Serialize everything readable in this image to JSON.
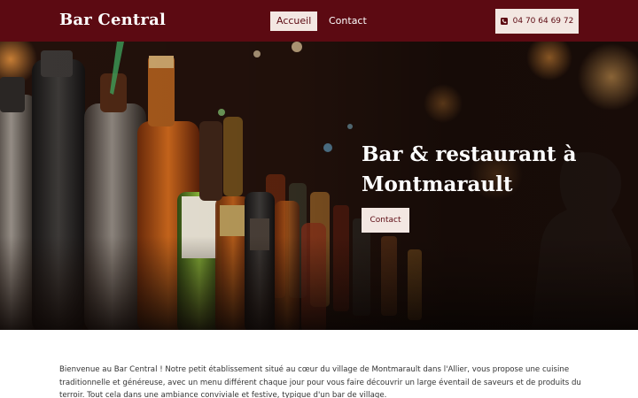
{
  "header": {
    "brand": "Bar Central",
    "nav": [
      {
        "label": "Accueil",
        "active": true
      },
      {
        "label": "Contact",
        "active": false
      }
    ],
    "phone": {
      "label": "04 70 64 69 72",
      "icon": "phone-icon"
    }
  },
  "hero": {
    "title": "Bar & restaurant à Montmarault",
    "button_label": "Contact"
  },
  "intro": {
    "text": "Bienvenue au Bar Central ! Notre petit établissement situé au cœur du village de Montmarault dans l'Allier, vous propose une cuisine traditionnelle et généreuse, avec un menu différent chaque jour pour vous faire découvrir un large éventail de saveurs et de produits du terroir. Tout cela dans une ambiance conviviale et festive, typique d'un bar de village."
  },
  "colors": {
    "primary": "#5c0a12",
    "button_bg": "#f3e7e2",
    "text": "#333333"
  }
}
